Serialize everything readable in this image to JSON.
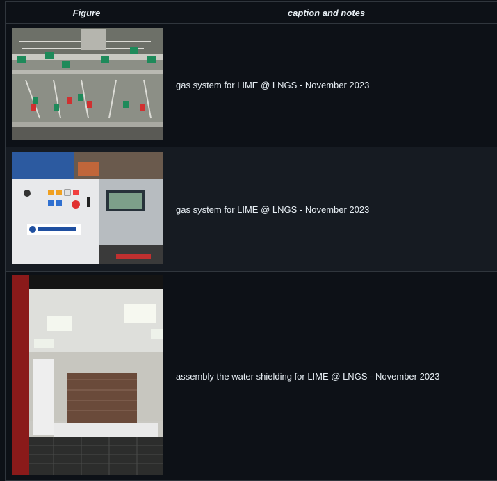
{
  "table": {
    "headers": {
      "figure": "Figure",
      "caption": "caption and notes"
    },
    "rows": [
      {
        "photo": "gas-system-manifold-photo",
        "caption": "gas system for LIME @ LNGS - November 2023"
      },
      {
        "photo": "gas-system-control-cabinet-photo",
        "caption": "gas system for LIME @ LNGS - November 2023"
      },
      {
        "photo": "water-shielding-assembly-photo",
        "caption": "assembly the water shielding for LIME @ LNGS - November 2023"
      }
    ]
  }
}
